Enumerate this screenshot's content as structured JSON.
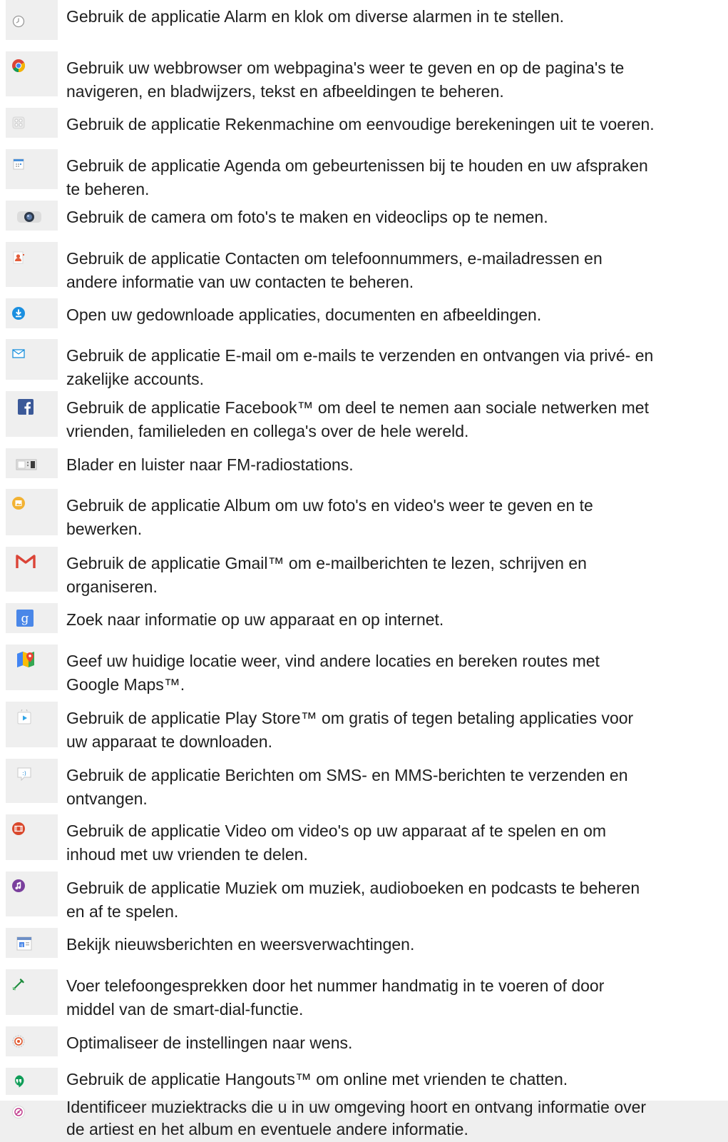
{
  "items": [
    {
      "icon": "alarm-clock-icon",
      "lines": [
        "Gebruik de applicatie Alarm en klok om diverse alarmen in te stellen."
      ]
    },
    {
      "icon": "chrome-browser-icon",
      "lines": [
        "Gebruik uw webbrowser om webpagina's weer te geven en op de pagina's te",
        "navigeren, en bladwijzers, tekst en afbeeldingen te beheren."
      ]
    },
    {
      "icon": "calculator-icon",
      "lines": [
        "Gebruik de applicatie Rekenmachine om eenvoudige berekeningen uit te voeren."
      ]
    },
    {
      "icon": "calendar-icon",
      "lines": [
        "Gebruik de applicatie Agenda om gebeurtenissen bij te houden en uw afspraken",
        "te beheren."
      ]
    },
    {
      "icon": "camera-icon",
      "lines": [
        "Gebruik de camera om foto's te maken en videoclips op te nemen."
      ]
    },
    {
      "icon": "contacts-icon",
      "lines": [
        "Gebruik de applicatie Contacten om telefoonnummers, e-mailadressen en",
        "andere informatie van uw contacten te beheren."
      ]
    },
    {
      "icon": "download-icon",
      "lines": [
        "Open uw gedownloade applicaties, documenten en afbeeldingen."
      ]
    },
    {
      "icon": "email-envelope-icon",
      "lines": [
        "Gebruik de applicatie E-mail om e-mails te verzenden en ontvangen via privé- en",
        "zakelijke accounts."
      ]
    },
    {
      "icon": "facebook-icon",
      "lines": [
        "Gebruik de applicatie Facebook™ om deel te nemen aan sociale netwerken met",
        "vrienden, familieleden en collega's over de hele wereld."
      ]
    },
    {
      "icon": "fm-radio-icon",
      "lines": [
        "Blader en luister naar FM-radiostations."
      ]
    },
    {
      "icon": "album-icon",
      "lines": [
        "Gebruik de applicatie Album om uw foto's en video's weer te geven en te",
        "bewerken."
      ]
    },
    {
      "icon": "gmail-icon",
      "lines": [
        "Gebruik de applicatie Gmail™ om e-mailberichten te lezen, schrijven en",
        "organiseren."
      ]
    },
    {
      "icon": "google-search-icon",
      "lines": [
        "Zoek naar informatie op uw apparaat en op internet."
      ]
    },
    {
      "icon": "google-maps-icon",
      "lines": [
        "Geef uw huidige locatie weer, vind andere locaties en bereken routes met",
        "Google Maps™."
      ]
    },
    {
      "icon": "play-store-icon",
      "lines": [
        "Gebruik de applicatie Play Store™ om gratis of tegen betaling applicaties voor",
        "uw apparaat te downloaden."
      ]
    },
    {
      "icon": "messaging-icon",
      "lines": [
        "Gebruik de applicatie Berichten om SMS- en MMS-berichten te verzenden en",
        "ontvangen."
      ]
    },
    {
      "icon": "video-icon",
      "lines": [
        "Gebruik de applicatie Video om video's op uw apparaat af te spelen en om",
        "inhoud met uw vrienden te delen."
      ]
    },
    {
      "icon": "music-icon",
      "lines": [
        "Gebruik de applicatie Muziek om muziek, audioboeken en podcasts te beheren",
        "en af te spelen."
      ]
    },
    {
      "icon": "news-weather-icon",
      "lines": [
        "Bekijk nieuwsberichten en weersverwachtingen."
      ]
    },
    {
      "icon": "phone-icon",
      "lines": [
        "Voer telefoongesprekken door het nummer handmatig in te voeren of door",
        "middel van de smart-dial-functie."
      ]
    },
    {
      "icon": "settings-icon",
      "lines": [
        "Optimaliseer de instellingen naar wens."
      ]
    },
    {
      "icon": "hangouts-icon",
      "lines": [
        "Gebruik de applicatie Hangouts™ om online met vrienden te chatten."
      ]
    },
    {
      "icon": "trackid-icon",
      "lines": [
        "Identificeer muziektracks die u in uw omgeving hoort en ontvang informatie over",
        "de artiest en het album en eventuele andere informatie."
      ]
    }
  ]
}
